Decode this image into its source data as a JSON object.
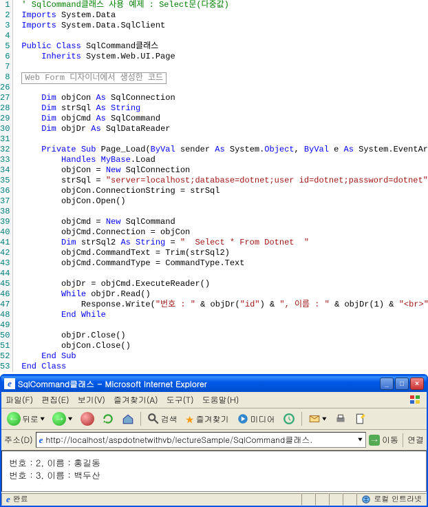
{
  "code": {
    "lines": [
      {
        "n": "1",
        "tokens": [
          {
            "t": "' SqlCommand클래스 사용 예제 : Select문(다중값)",
            "c": "c-comment"
          }
        ]
      },
      {
        "n": "2",
        "tokens": [
          {
            "t": "Imports",
            "c": "c-keyword"
          },
          {
            "t": " System.Data",
            "c": "c-normal"
          }
        ]
      },
      {
        "n": "3",
        "tokens": [
          {
            "t": "Imports",
            "c": "c-keyword"
          },
          {
            "t": " System.Data.SqlClient",
            "c": "c-normal"
          }
        ]
      },
      {
        "n": "4",
        "tokens": []
      },
      {
        "n": "5",
        "tokens": [
          {
            "t": "Public Class",
            "c": "c-keyword"
          },
          {
            "t": " SqlCommand클래스",
            "c": "c-normal"
          }
        ]
      },
      {
        "n": "6",
        "tokens": [
          {
            "t": "    ",
            "c": ""
          },
          {
            "t": "Inherits",
            "c": "c-keyword"
          },
          {
            "t": " System.Web.UI.Page",
            "c": "c-normal"
          }
        ]
      },
      {
        "n": "7",
        "tokens": []
      },
      {
        "n": "8",
        "region": "Web Form 디자이너에서 생성한 코드"
      },
      {
        "n": "26",
        "tokens": []
      },
      {
        "n": "27",
        "tokens": [
          {
            "t": "    ",
            "c": ""
          },
          {
            "t": "Dim",
            "c": "c-keyword"
          },
          {
            "t": " objCon ",
            "c": "c-normal"
          },
          {
            "t": "As",
            "c": "c-keyword"
          },
          {
            "t": " SqlConnection",
            "c": "c-normal"
          }
        ]
      },
      {
        "n": "28",
        "tokens": [
          {
            "t": "    ",
            "c": ""
          },
          {
            "t": "Dim",
            "c": "c-keyword"
          },
          {
            "t": " strSql ",
            "c": "c-normal"
          },
          {
            "t": "As String",
            "c": "c-keyword"
          }
        ]
      },
      {
        "n": "29",
        "tokens": [
          {
            "t": "    ",
            "c": ""
          },
          {
            "t": "Dim",
            "c": "c-keyword"
          },
          {
            "t": " objCmd ",
            "c": "c-normal"
          },
          {
            "t": "As",
            "c": "c-keyword"
          },
          {
            "t": " SqlCommand",
            "c": "c-normal"
          }
        ]
      },
      {
        "n": "30",
        "tokens": [
          {
            "t": "    ",
            "c": ""
          },
          {
            "t": "Dim",
            "c": "c-keyword"
          },
          {
            "t": " objDr ",
            "c": "c-normal"
          },
          {
            "t": "As",
            "c": "c-keyword"
          },
          {
            "t": " SqlDataReader",
            "c": "c-normal"
          }
        ]
      },
      {
        "n": "31",
        "tokens": []
      },
      {
        "n": "32",
        "tokens": [
          {
            "t": "    ",
            "c": ""
          },
          {
            "t": "Private Sub",
            "c": "c-keyword"
          },
          {
            "t": " Page_Load(",
            "c": "c-normal"
          },
          {
            "t": "ByVal",
            "c": "c-keyword"
          },
          {
            "t": " sender ",
            "c": "c-normal"
          },
          {
            "t": "As",
            "c": "c-keyword"
          },
          {
            "t": " System.",
            "c": "c-normal"
          },
          {
            "t": "Object",
            "c": "c-keyword"
          },
          {
            "t": ", ",
            "c": "c-normal"
          },
          {
            "t": "ByVal",
            "c": "c-keyword"
          },
          {
            "t": " e ",
            "c": "c-normal"
          },
          {
            "t": "As",
            "c": "c-keyword"
          },
          {
            "t": " System.EventArgs) _",
            "c": "c-normal"
          }
        ]
      },
      {
        "n": "33",
        "tokens": [
          {
            "t": "        ",
            "c": ""
          },
          {
            "t": "Handles MyBase",
            "c": "c-keyword"
          },
          {
            "t": ".Load",
            "c": "c-normal"
          }
        ]
      },
      {
        "n": "34",
        "tokens": [
          {
            "t": "        objCon = ",
            "c": "c-normal"
          },
          {
            "t": "New",
            "c": "c-keyword"
          },
          {
            "t": " SqlConnection",
            "c": "c-normal"
          }
        ]
      },
      {
        "n": "35",
        "tokens": [
          {
            "t": "        strSql = ",
            "c": "c-normal"
          },
          {
            "t": "\"server=localhost;database=dotnet;user id=dotnet;password=dotnet\"",
            "c": "c-string"
          }
        ]
      },
      {
        "n": "36",
        "tokens": [
          {
            "t": "        objCon.ConnectionString = strSql",
            "c": "c-normal"
          }
        ]
      },
      {
        "n": "37",
        "tokens": [
          {
            "t": "        objCon.Open()",
            "c": "c-normal"
          }
        ]
      },
      {
        "n": "38",
        "tokens": []
      },
      {
        "n": "39",
        "tokens": [
          {
            "t": "        objCmd = ",
            "c": "c-normal"
          },
          {
            "t": "New",
            "c": "c-keyword"
          },
          {
            "t": " SqlCommand",
            "c": "c-normal"
          }
        ]
      },
      {
        "n": "40",
        "tokens": [
          {
            "t": "        objCmd.Connection = objCon",
            "c": "c-normal"
          }
        ]
      },
      {
        "n": "41",
        "tokens": [
          {
            "t": "        ",
            "c": ""
          },
          {
            "t": "Dim",
            "c": "c-keyword"
          },
          {
            "t": " strSql2 ",
            "c": "c-normal"
          },
          {
            "t": "As String",
            "c": "c-keyword"
          },
          {
            "t": " = ",
            "c": "c-normal"
          },
          {
            "t": "\"  Select * From Dotnet  \"",
            "c": "c-string"
          }
        ]
      },
      {
        "n": "42",
        "tokens": [
          {
            "t": "        objCmd.CommandText = Trim(strSql2)",
            "c": "c-normal"
          }
        ]
      },
      {
        "n": "43",
        "tokens": [
          {
            "t": "        objCmd.CommandType = CommandType.Text",
            "c": "c-normal"
          }
        ]
      },
      {
        "n": "44",
        "tokens": []
      },
      {
        "n": "45",
        "tokens": [
          {
            "t": "        objDr = objCmd.ExecuteReader()",
            "c": "c-normal"
          }
        ]
      },
      {
        "n": "46",
        "tokens": [
          {
            "t": "        ",
            "c": ""
          },
          {
            "t": "While",
            "c": "c-keyword"
          },
          {
            "t": " objDr.Read()",
            "c": "c-normal"
          }
        ]
      },
      {
        "n": "47",
        "tokens": [
          {
            "t": "            Response.Write(",
            "c": "c-normal"
          },
          {
            "t": "\"번호 : \"",
            "c": "c-string"
          },
          {
            "t": " & objDr(",
            "c": "c-normal"
          },
          {
            "t": "\"id\"",
            "c": "c-string"
          },
          {
            "t": ") & ",
            "c": "c-normal"
          },
          {
            "t": "\", 이름 : \"",
            "c": "c-string"
          },
          {
            "t": " & objDr(1) & ",
            "c": "c-normal"
          },
          {
            "t": "\"<br>\"",
            "c": "c-string"
          },
          {
            "t": ")",
            "c": "c-normal"
          }
        ]
      },
      {
        "n": "48",
        "tokens": [
          {
            "t": "        ",
            "c": ""
          },
          {
            "t": "End While",
            "c": "c-keyword"
          }
        ]
      },
      {
        "n": "49",
        "tokens": []
      },
      {
        "n": "50",
        "tokens": [
          {
            "t": "        objDr.Close()",
            "c": "c-normal"
          }
        ]
      },
      {
        "n": "51",
        "tokens": [
          {
            "t": "        objCon.Close()",
            "c": "c-normal"
          }
        ]
      },
      {
        "n": "52",
        "tokens": [
          {
            "t": "    ",
            "c": ""
          },
          {
            "t": "End Sub",
            "c": "c-keyword"
          }
        ]
      },
      {
        "n": "53",
        "tokens": [
          {
            "t": "End Class",
            "c": "c-keyword"
          }
        ]
      }
    ]
  },
  "browser": {
    "title": "SqlCommand클래스 - Microsoft Internet Explorer",
    "menus": {
      "file": "파일(F)",
      "edit": "편집(E)",
      "view": "보기(V)",
      "fav": "즐겨찾기(A)",
      "tools": "도구(T)",
      "help": "도움말(H)"
    },
    "toolbar": {
      "back": "뒤로",
      "search": "검색",
      "fav": "즐겨찾기",
      "media": "미디어"
    },
    "address_label": "주소(D)",
    "url": "http://localhost/aspdotnetwithvb/lectureSample/SqlCommand클래스.",
    "go": "이동",
    "links": "연결",
    "content": [
      "번호 : 2, 이름 : 홍길동",
      "번호 : 3, 이름 : 백두산"
    ],
    "status_done": "완료",
    "status_zone": "로컬 인트라넷"
  }
}
